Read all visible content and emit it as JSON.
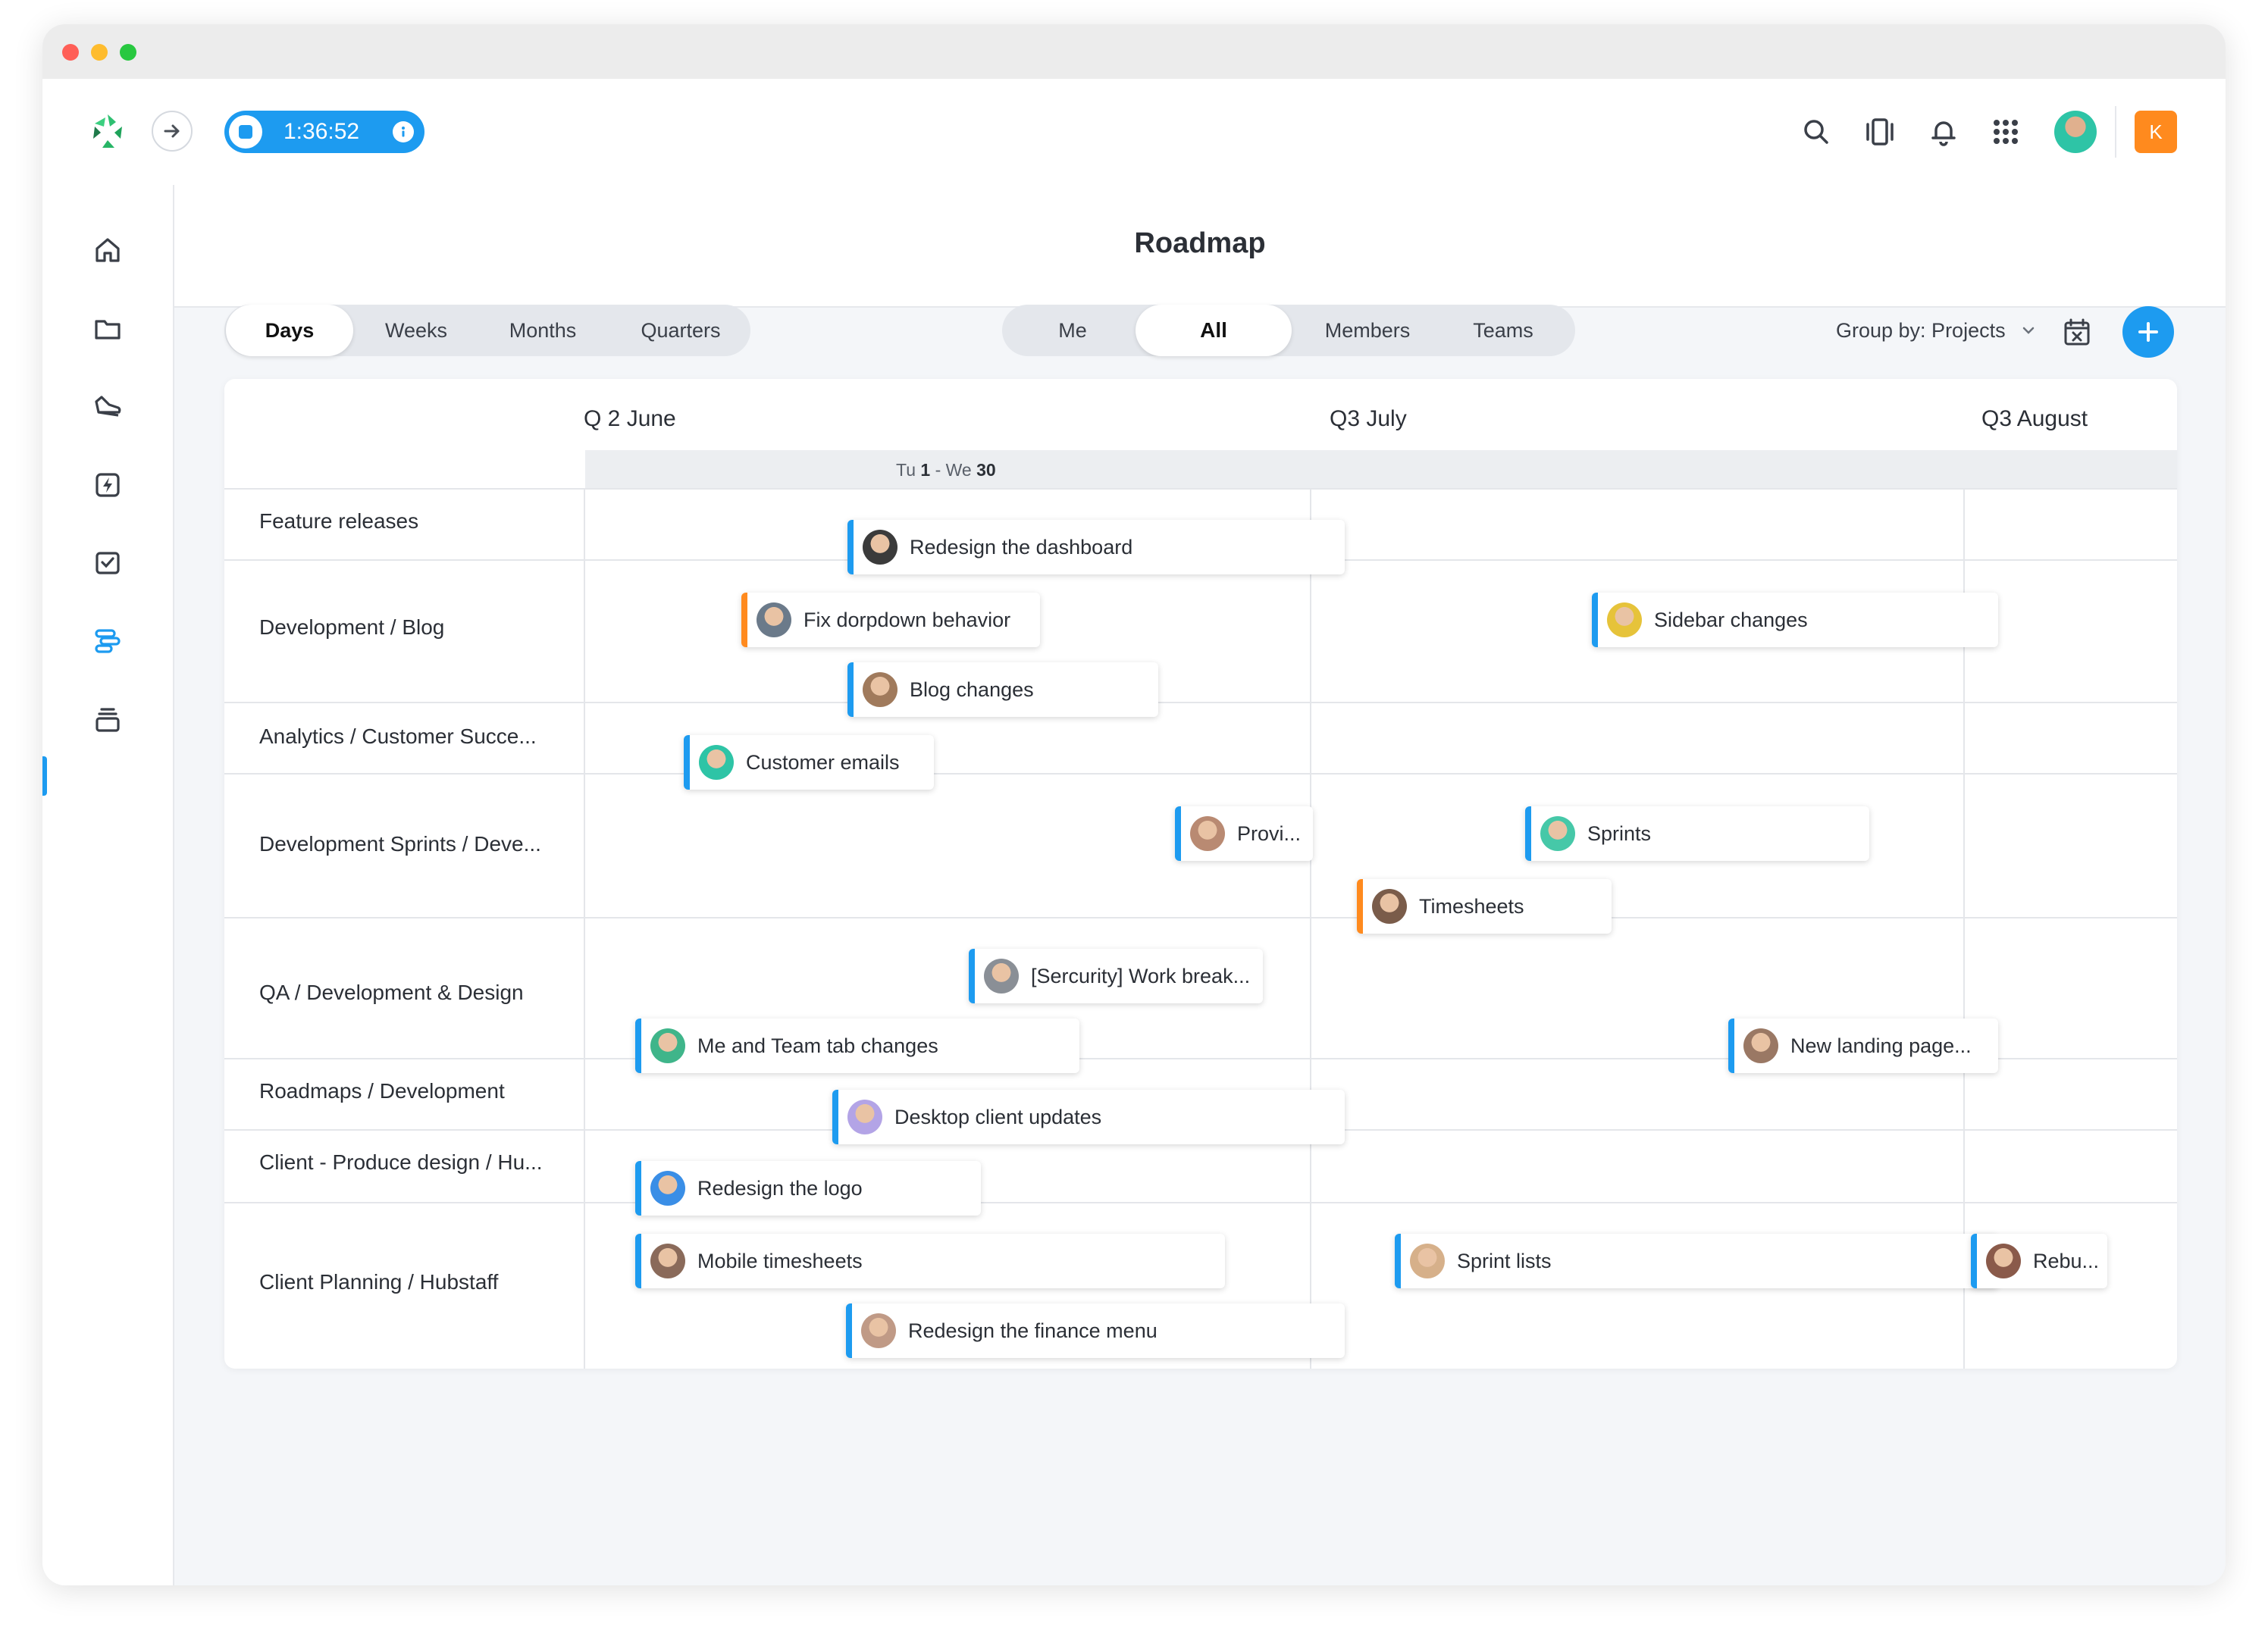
{
  "window": {
    "traffic_lights": [
      "#ff5f57",
      "#febc2e",
      "#28c840"
    ]
  },
  "topbar": {
    "timer": "1:36:52",
    "user_initial": "K",
    "icons": [
      "logo-icon",
      "collapse-arrow-icon",
      "stop-icon",
      "info-icon",
      "search-icon",
      "activity-icon",
      "bell-icon",
      "apps-grid-icon",
      "avatar",
      "account-badge"
    ]
  },
  "sidebar": {
    "items": [
      "home-icon",
      "folder-icon",
      "shoe-icon",
      "lightning-icon",
      "checkbox-icon",
      "roadmap-icon",
      "inbox-icon"
    ]
  },
  "page": {
    "title": "Roadmap"
  },
  "range_tabs": [
    "Days",
    "Weeks",
    "Months",
    "Quarters"
  ],
  "scope_tabs": [
    "Me",
    "All",
    "Members",
    "Teams"
  ],
  "group_by": "Group by: Projects",
  "timeline": {
    "months": [
      "Q 2 June",
      "Q3 July",
      "Q3 August"
    ],
    "day_range": {
      "start_prefix": "Tu ",
      "start_day": "1",
      "separator": " - We ",
      "end_day": "30"
    }
  },
  "rows": [
    "Feature releases",
    "Development / Blog",
    "Analytics / Customer Succe...",
    "Development Sprints / Deve...",
    "QA / Development & Design",
    "Roadmaps / Development",
    "Client - Produce design / Hu...",
    "Client Planning / Hubstaff"
  ],
  "tasks": [
    {
      "label": "Redesign the dashboard",
      "accent": "#1d9bf0",
      "avatar": "#3b3b3b"
    },
    {
      "label": "Fix dorpdown behavior",
      "accent": "#ff8a1e",
      "avatar": "#6b7a8a"
    },
    {
      "label": "Blog changes",
      "accent": "#1d9bf0",
      "avatar": "#a07a5c"
    },
    {
      "label": "Sidebar changes",
      "accent": "#1d9bf0",
      "avatar": "#e6c33a"
    },
    {
      "label": "Customer emails",
      "accent": "#1d9bf0",
      "avatar": "#2ec4a6"
    },
    {
      "label": "Provi...",
      "accent": "#1d9bf0",
      "avatar": "#b98a72"
    },
    {
      "label": "Sprints",
      "accent": "#1d9bf0",
      "avatar": "#46c8a8"
    },
    {
      "label": "Timesheets",
      "accent": "#ff8a1e",
      "avatar": "#7a5c4a"
    },
    {
      "label": "[Sercurity] Work break...",
      "accent": "#1d9bf0",
      "avatar": "#8a8f96"
    },
    {
      "label": "Me and Team tab changes",
      "accent": "#1d9bf0",
      "avatar": "#3fb58a"
    },
    {
      "label": "New landing page...",
      "accent": "#1d9bf0",
      "avatar": "#9a7864"
    },
    {
      "label": "Desktop client updates",
      "accent": "#1d9bf0",
      "avatar": "#b3a4e6"
    },
    {
      "label": "Redesign the logo",
      "accent": "#1d9bf0",
      "avatar": "#3a8ee6"
    },
    {
      "label": "Mobile timesheets",
      "accent": "#1d9bf0",
      "avatar": "#8a6a5a"
    },
    {
      "label": "Redesign the finance menu",
      "accent": "#1d9bf0",
      "avatar": "#c09a86"
    },
    {
      "label": "Sprint lists",
      "accent": "#1d9bf0",
      "avatar": "#d6b08a"
    },
    {
      "label": "Rebu...",
      "accent": "#1d9bf0",
      "avatar": "#8a5a4a"
    }
  ]
}
